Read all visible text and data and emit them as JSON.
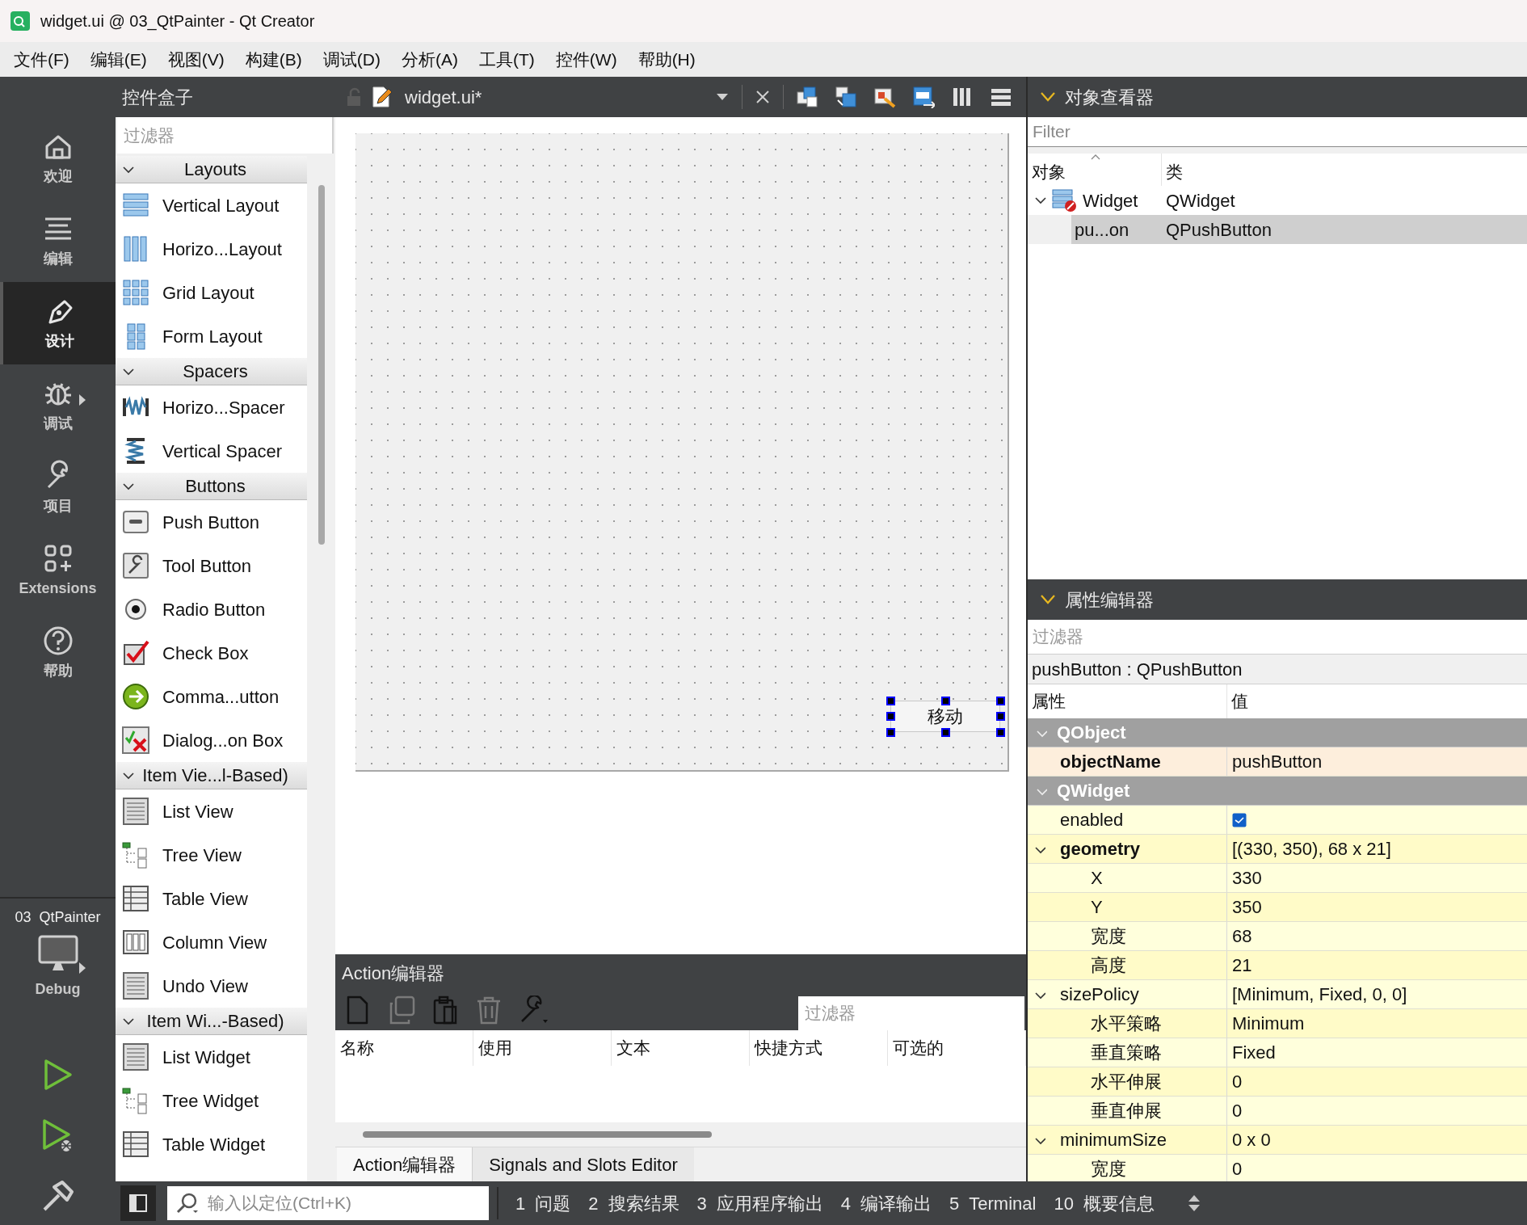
{
  "window": {
    "title": "widget.ui @ 03_QtPainter - Qt Creator"
  },
  "menu": [
    "文件(F)",
    "编辑(E)",
    "视图(V)",
    "构建(B)",
    "调试(D)",
    "分析(A)",
    "工具(T)",
    "控件(W)",
    "帮助(H)"
  ],
  "mode_bar": {
    "modes": [
      {
        "kind": "home",
        "label": "欢迎",
        "selected": false
      },
      {
        "kind": "edit",
        "label": "编辑",
        "selected": false
      },
      {
        "kind": "design",
        "label": "设计",
        "selected": true
      },
      {
        "kind": "debug",
        "label": "调试",
        "selected": false
      },
      {
        "kind": "project",
        "label": "项目",
        "selected": false
      },
      {
        "kind": "extensions",
        "label": "Extensions",
        "selected": false
      },
      {
        "kind": "help",
        "label": "帮助",
        "selected": false
      }
    ],
    "project": "03  QtPainter",
    "build_config": "Debug"
  },
  "widget_box": {
    "title": "控件盒子",
    "filter_placeholder": "过滤器",
    "categories": [
      {
        "label": "Layouts",
        "expanded": true,
        "items": [
          {
            "kind": "vlayout",
            "label": "Vertical Layout"
          },
          {
            "kind": "hlayout",
            "label": "Horizo...Layout"
          },
          {
            "kind": "grid",
            "label": "Grid Layout"
          },
          {
            "kind": "form",
            "label": "Form Layout"
          }
        ]
      },
      {
        "label": "Spacers",
        "expanded": true,
        "items": [
          {
            "kind": "hspacer",
            "label": "Horizo...Spacer"
          },
          {
            "kind": "vspacer",
            "label": "Vertical Spacer"
          }
        ]
      },
      {
        "label": "Buttons",
        "expanded": true,
        "items": [
          {
            "kind": "pushbutton",
            "label": "Push Button"
          },
          {
            "kind": "toolbutton",
            "label": "Tool Button"
          },
          {
            "kind": "radio",
            "label": "Radio Button"
          },
          {
            "kind": "checkbox",
            "label": "Check Box"
          },
          {
            "kind": "command",
            "label": "Comma...utton"
          },
          {
            "kind": "dialogbuttons",
            "label": "Dialog...on Box"
          }
        ]
      },
      {
        "label": "Item Vie...l-Based)",
        "expanded": true,
        "items": [
          {
            "kind": "list",
            "label": "List View"
          },
          {
            "kind": "tree",
            "label": "Tree View"
          },
          {
            "kind": "table",
            "label": "Table View"
          },
          {
            "kind": "columns",
            "label": "Column View"
          },
          {
            "kind": "list",
            "label": "Undo View"
          }
        ]
      },
      {
        "label": "Item Wi...-Based)",
        "expanded": true,
        "items": [
          {
            "kind": "list",
            "label": "List Widget"
          },
          {
            "kind": "tree",
            "label": "Tree Widget"
          },
          {
            "kind": "table",
            "label": "Table Widget"
          }
        ]
      }
    ]
  },
  "editor": {
    "file": "widget.ui*",
    "form": {
      "button_text": "移动",
      "button_selected": true
    }
  },
  "action_editor": {
    "title": "Action编辑器",
    "toolbar": [
      {
        "kind": "new",
        "disabled": false
      },
      {
        "kind": "copy",
        "disabled": true
      },
      {
        "kind": "paste",
        "disabled": false
      },
      {
        "kind": "delete",
        "disabled": true
      },
      {
        "kind": "settings",
        "disabled": false
      }
    ],
    "filter_placeholder": "过滤器",
    "columns": [
      "名称",
      "使用",
      "文本",
      "快捷方式",
      "可选的"
    ],
    "tabs": [
      {
        "label": "Action编辑器",
        "selected": true
      },
      {
        "label": "Signals and Slots Editor",
        "selected": false
      }
    ]
  },
  "object_inspector": {
    "title": "对象查看器",
    "filter_placeholder": "Filter",
    "columns": [
      "对象",
      "类"
    ],
    "tree": [
      {
        "name": "Widget",
        "class": "QWidget",
        "expanded": true,
        "selected": false,
        "children": [
          {
            "name": "pu...on",
            "class": "QPushButton",
            "selected": true
          }
        ]
      }
    ]
  },
  "property_editor": {
    "title": "属性编辑器",
    "filter_placeholder": "过滤器",
    "object": "pushButton : QPushButton",
    "columns": [
      "属性",
      "值"
    ],
    "groups": [
      {
        "name": "QObject",
        "expanded": true,
        "children": [
          {
            "name": "objectName",
            "kind": "text",
            "value": "pushButton",
            "modified": true
          }
        ]
      },
      {
        "name": "QWidget",
        "expanded": true,
        "children": [
          {
            "name": "enabled",
            "kind": "checkbox",
            "checked": true,
            "modified": false
          },
          {
            "name": "geometry",
            "kind": "text",
            "value": "[(330, 350), 68 x 21]",
            "modified": true,
            "expanded": true,
            "children": [
              {
                "name": "X",
                "kind": "text",
                "value": "330",
                "modified": false
              },
              {
                "name": "Y",
                "kind": "text",
                "value": "350",
                "modified": false
              },
              {
                "name": "宽度",
                "kind": "text",
                "value": "68",
                "modified": false
              },
              {
                "name": "高度",
                "kind": "text",
                "value": "21",
                "modified": false
              }
            ]
          },
          {
            "name": "sizePolicy",
            "kind": "text",
            "value": "[Minimum, Fixed, 0, 0]",
            "modified": false,
            "expanded": true,
            "children": [
              {
                "name": "水平策略",
                "kind": "text",
                "value": "Minimum",
                "modified": false
              },
              {
                "name": "垂直策略",
                "kind": "text",
                "value": "Fixed",
                "modified": false
              },
              {
                "name": "水平伸展",
                "kind": "text",
                "value": "0",
                "modified": false
              },
              {
                "name": "垂直伸展",
                "kind": "text",
                "value": "0",
                "modified": false
              }
            ]
          },
          {
            "name": "minimumSize",
            "kind": "text",
            "value": "0 x 0",
            "modified": false,
            "expanded": true,
            "children": [
              {
                "name": "宽度",
                "kind": "text",
                "value": "0",
                "modified": false
              }
            ]
          }
        ]
      }
    ]
  },
  "status_bar": {
    "locator_placeholder": "输入以定位(Ctrl+K)",
    "panes": [
      {
        "number": "1",
        "label": "问题"
      },
      {
        "number": "2",
        "label": "搜索结果"
      },
      {
        "number": "3",
        "label": "应用程序输出"
      },
      {
        "number": "4",
        "label": "编译输出"
      },
      {
        "number": "5",
        "label": "Terminal"
      },
      {
        "number": "10",
        "label": "概要信息"
      }
    ]
  }
}
